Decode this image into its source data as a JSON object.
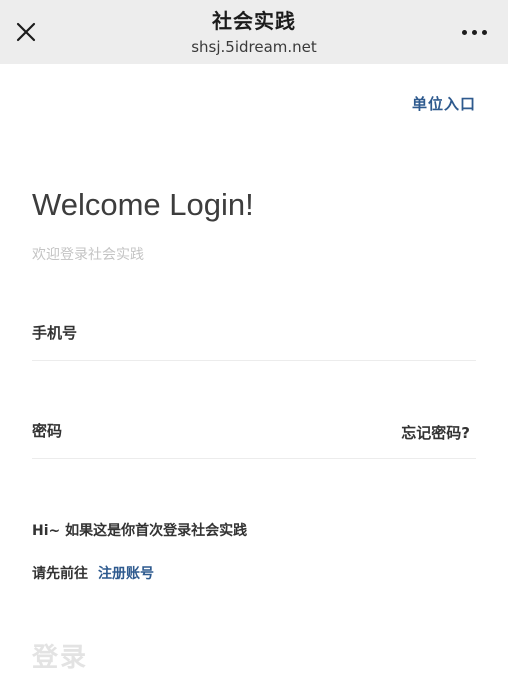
{
  "browser": {
    "title": "社会实践",
    "url": "shsj.5idream.net",
    "close_icon": "close-icon",
    "more_icon": "more-dots-icon"
  },
  "login": {
    "unit_entry": "单位入口",
    "welcome": "Welcome Login!",
    "subtitle": "欢迎登录社会实践",
    "phone_placeholder": "手机号",
    "password_placeholder": "密码",
    "forgot_password": "忘记密码?",
    "hint_line1": "Hi~ 如果这是你首次登录社会实践",
    "hint_line2_prefix": "请先前往",
    "register_link": "注册账号",
    "login_button": "登录"
  },
  "colors": {
    "accent": "#2e5a8e",
    "header_bg": "#ededed",
    "disabled_text": "#e3e3e3"
  }
}
